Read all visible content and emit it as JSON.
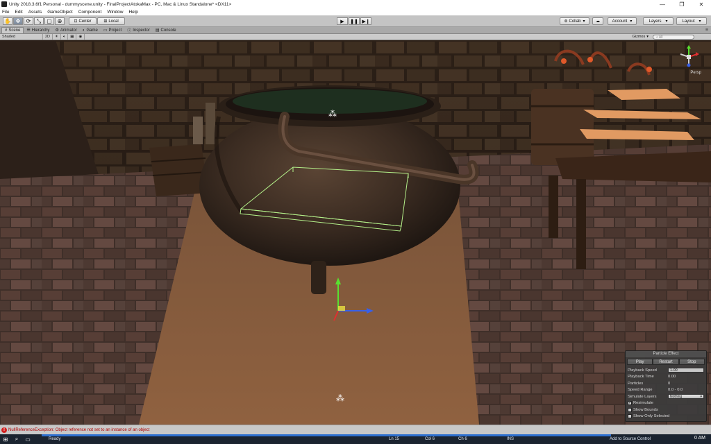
{
  "window": {
    "title": "Unity 2018.3.6f1 Personal - dummyscene.unity - FinalProjectAtokaMax - PC, Mac & Linux Standalone* <DX11>",
    "minimize_glyph": "—",
    "maximize_glyph": "❐",
    "close_glyph": "✕"
  },
  "menu": {
    "items": [
      "File",
      "Edit",
      "Assets",
      "GameObject",
      "Component",
      "Window",
      "Help"
    ]
  },
  "toolbar": {
    "pivot_label": "Center",
    "space_label": "Local",
    "collab_label": "Collab",
    "account_label": "Account",
    "layers_label": "Layers",
    "layout_label": "Layout"
  },
  "tabs": {
    "items": [
      {
        "label": "Scene",
        "icon": "scene-icon"
      },
      {
        "label": "Hierarchy",
        "icon": "hierarchy-icon"
      },
      {
        "label": "Animator",
        "icon": "animator-icon"
      },
      {
        "label": "Game",
        "icon": "game-icon"
      },
      {
        "label": "Project",
        "icon": "project-icon"
      },
      {
        "label": "Inspector",
        "icon": "inspector-icon"
      },
      {
        "label": "Console",
        "icon": "console-icon"
      }
    ]
  },
  "scene_options": {
    "shading_mode": "Shaded",
    "mode_2d": "2D",
    "gizmos_label": "Gizmos",
    "search_placeholder": "All"
  },
  "gizmo": {
    "projection_label": "Persp"
  },
  "particle_effect": {
    "title": "Particle Effect",
    "play_label": "Play",
    "restart_label": "Restart",
    "stop_label": "Stop",
    "playback_speed_label": "Playback Speed",
    "playback_speed_value": "1.00",
    "playback_time_label": "Playback Time",
    "playback_time_value": "0.00",
    "particles_label": "Particles",
    "particles_value": "0",
    "speed_range_label": "Speed Range",
    "speed_range_value": "0.0 - 0.0",
    "simulate_layers_label": "Simulate Layers",
    "simulate_layers_value": "Nothing",
    "resimulate_label": "Resimulate",
    "resimulate_checked": true,
    "show_bounds_label": "Show Bounds",
    "show_bounds_checked": false,
    "show_only_selected_label": "Show Only Selected",
    "show_only_selected_checked": false
  },
  "console": {
    "error_message": "NullReferenceException: Object reference not set to an instance of an object"
  },
  "taskbar": {
    "status_ready": "Ready",
    "ln": "Ln 15",
    "col": "Col 6",
    "ch": "Ch 6",
    "ins": "INS",
    "source_control": "Add to Source Control",
    "clock": "0 AM"
  },
  "colors": {
    "error_red": "#b00000",
    "taskbar_bg": "#1b2430",
    "vs_status_blue": "#2d6fcf",
    "panel_bg": "#3c3c3c"
  }
}
